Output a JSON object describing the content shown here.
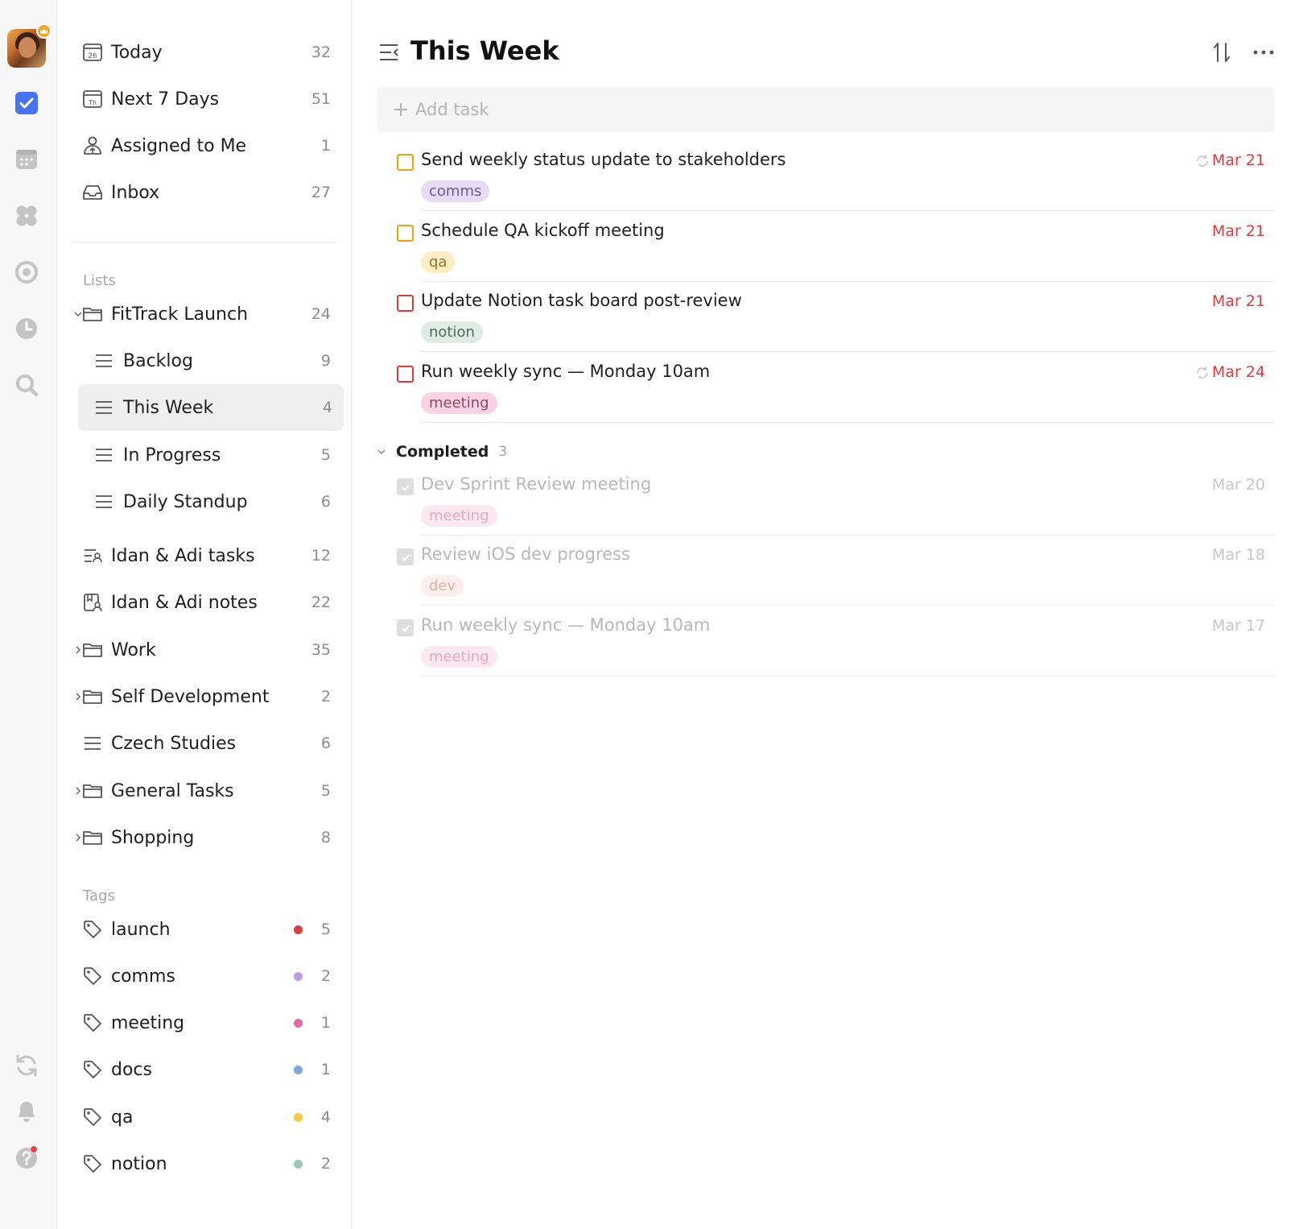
{
  "nav": {
    "smart_lists": [
      {
        "label": "Today",
        "count": "32",
        "icon": "calendar-today-icon"
      },
      {
        "label": "Next 7 Days",
        "count": "51",
        "icon": "calendar-week-icon"
      },
      {
        "label": "Assigned to Me",
        "count": "1",
        "icon": "assigned-user-icon"
      },
      {
        "label": "Inbox",
        "count": "27",
        "icon": "inbox-icon"
      }
    ],
    "lists_header": "Lists",
    "lists": [
      {
        "label": "FitTrack Launch",
        "count": "24",
        "type": "folder",
        "expanded": true
      },
      {
        "label": "Backlog",
        "count": "9",
        "type": "list",
        "child": true
      },
      {
        "label": "This Week",
        "count": "4",
        "type": "list",
        "child": true,
        "active": true
      },
      {
        "label": "In Progress",
        "count": "5",
        "type": "list",
        "child": true
      },
      {
        "label": "Daily Standup",
        "count": "6",
        "type": "list",
        "child": true
      },
      {
        "label": "Idan & Adi tasks",
        "count": "12",
        "type": "shared-list"
      },
      {
        "label": "Idan & Adi notes",
        "count": "22",
        "type": "shared-notes"
      },
      {
        "label": "Work",
        "count": "35",
        "type": "folder"
      },
      {
        "label": "Self Development",
        "count": "2",
        "type": "folder"
      },
      {
        "label": "Czech Studies",
        "count": "6",
        "type": "list"
      },
      {
        "label": "General Tasks",
        "count": "5",
        "type": "folder"
      },
      {
        "label": "Shopping",
        "count": "8",
        "type": "folder"
      }
    ],
    "tags_header": "Tags",
    "tags": [
      {
        "label": "launch",
        "count": "5",
        "color": "#e5383b"
      },
      {
        "label": "comms",
        "count": "2",
        "color": "#b99ce8"
      },
      {
        "label": "meeting",
        "count": "1",
        "color": "#e86aa0"
      },
      {
        "label": "docs",
        "count": "1",
        "color": "#7aa7e0"
      },
      {
        "label": "qa",
        "count": "4",
        "color": "#f7c948"
      },
      {
        "label": "notion",
        "count": "2",
        "color": "#9cc7b4"
      }
    ]
  },
  "main": {
    "title": "This Week",
    "add_task_placeholder": "Add task",
    "tasks": [
      {
        "title": "Send weekly status update to stakeholders",
        "tag": "comms",
        "date": "Mar 21",
        "repeat": true,
        "priority": "medium"
      },
      {
        "title": "Schedule QA kickoff meeting",
        "tag": "qa",
        "date": "Mar 21",
        "repeat": false,
        "priority": "medium"
      },
      {
        "title": "Update Notion task board post-review",
        "tag": "notion",
        "date": "Mar 21",
        "repeat": false,
        "priority": "high"
      },
      {
        "title": "Run weekly sync — Monday 10am",
        "tag": "meeting",
        "date": "Mar 24",
        "repeat": true,
        "priority": "high"
      }
    ],
    "completed_label": "Completed",
    "completed_count": "3",
    "completed_tasks": [
      {
        "title": "Dev Sprint Review meeting",
        "tag": "meeting",
        "date": "Mar 20"
      },
      {
        "title": "Review iOS dev progress",
        "tag": "dev",
        "date": "Mar 18"
      },
      {
        "title": "Run weekly sync — Monday 10am",
        "tag": "meeting",
        "date": "Mar 17"
      }
    ]
  },
  "colors": {
    "accent": "#4772fa",
    "overdue": "#e5383b",
    "priority_medium": "#f59e0b",
    "priority_high": "#e5383b"
  }
}
